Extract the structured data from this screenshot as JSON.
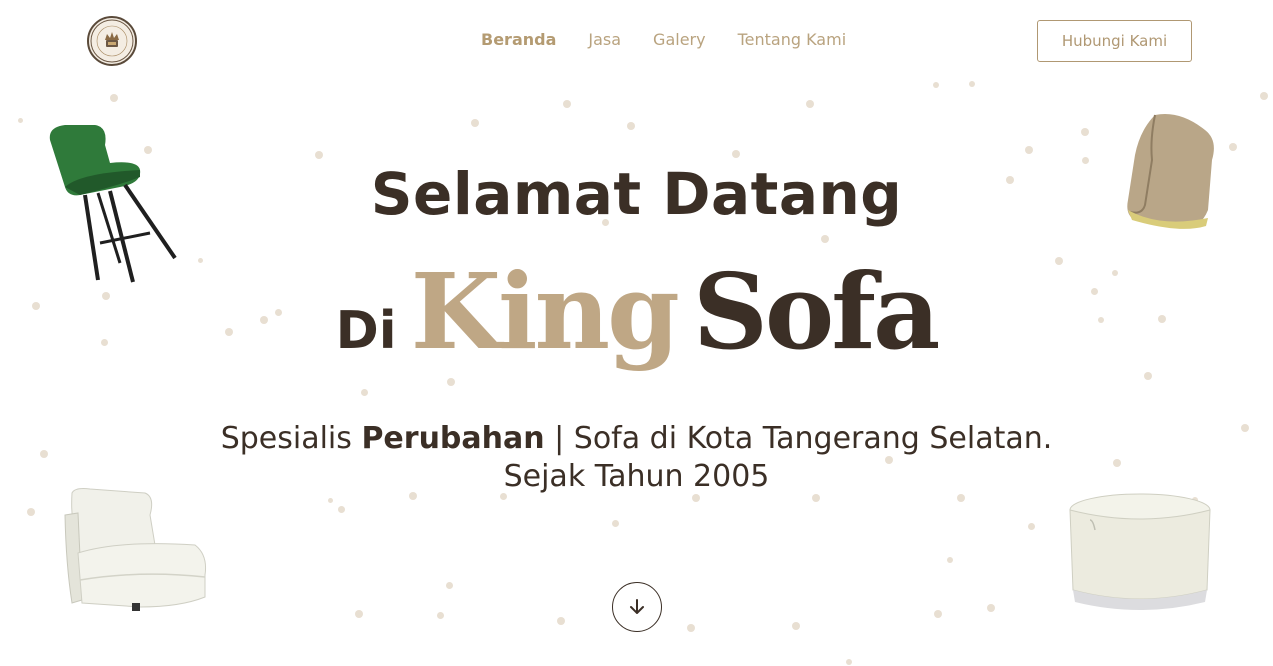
{
  "header": {
    "logo_alt": "KING SOFA",
    "nav": [
      {
        "label": "Beranda",
        "active": true
      },
      {
        "label": "Jasa",
        "active": false
      },
      {
        "label": "Galery",
        "active": false
      },
      {
        "label": "Tentang Kami",
        "active": false
      }
    ],
    "contact_button": "Hubungi Kami"
  },
  "hero": {
    "title": "Selamat Datang",
    "brand_prefix": "Di",
    "brand_king": "King",
    "brand_sofa": "Sofa",
    "tagline_part1": "Spesialis ",
    "tagline_bold": "Perubahan",
    "tagline_part2": " | Sofa di Kota Tangerang Selatan.",
    "tagline_line2": "Sejak Tahun 2005"
  },
  "icons": {
    "scroll_down": "arrow-down-icon"
  },
  "colors": {
    "accent": "#bfa785",
    "dark": "#3b2f26",
    "nav": "#b9a37f",
    "dot": "#e8dfd2"
  }
}
